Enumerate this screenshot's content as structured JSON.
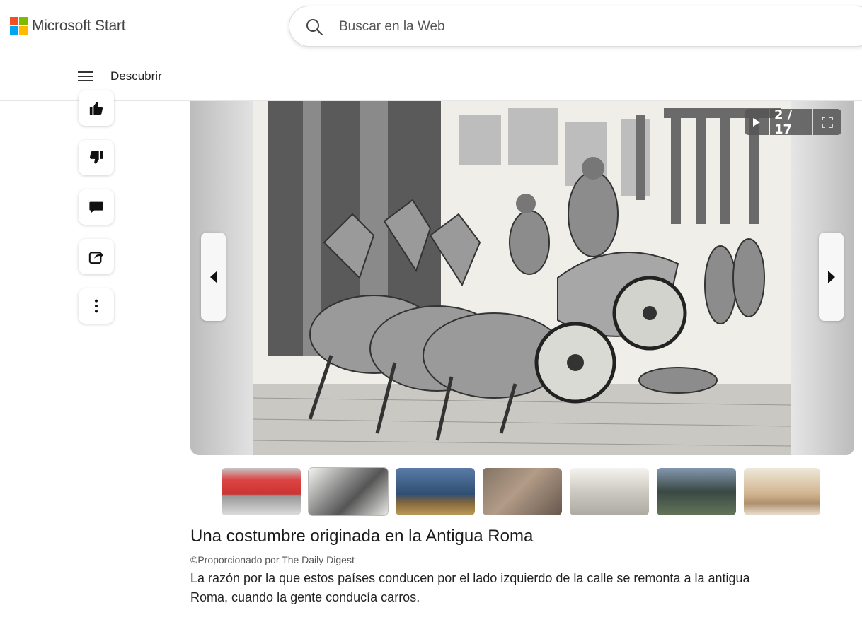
{
  "header": {
    "brand": "Microsoft Start",
    "logo_colors": [
      "#f25022",
      "#7fba00",
      "#00a4ef",
      "#ffb900"
    ],
    "search_placeholder": "Buscar en la Web"
  },
  "nav": {
    "menu_label": "Descubrir"
  },
  "actions": [
    {
      "icon": "thumbs-up-icon"
    },
    {
      "icon": "thumbs-down-icon"
    },
    {
      "icon": "comment-icon"
    },
    {
      "icon": "share-icon"
    },
    {
      "icon": "more-vertical-icon"
    }
  ],
  "slideshow": {
    "counter": "2 / 17",
    "current": 2,
    "total": 17,
    "image_description_icon": "engraving-image"
  },
  "thumbnails": [
    {
      "name": "thumb-1",
      "tone": "red-bus"
    },
    {
      "name": "thumb-2",
      "tone": "roman-chariot"
    },
    {
      "name": "thumb-3",
      "tone": "knights"
    },
    {
      "name": "thumb-4",
      "tone": "swords"
    },
    {
      "name": "thumb-5",
      "tone": "old-street"
    },
    {
      "name": "thumb-6",
      "tone": "forest-soldiers"
    },
    {
      "name": "thumb-7",
      "tone": "carriage"
    }
  ],
  "article": {
    "title": "Una costumbre originada en la Antigua Roma",
    "credit": "©Proporcionado por The Daily Digest",
    "description": "La razón por la que estos países conducen por el lado izquierdo de la calle se remonta a la antigua Roma, cuando la gente conducía carros."
  }
}
